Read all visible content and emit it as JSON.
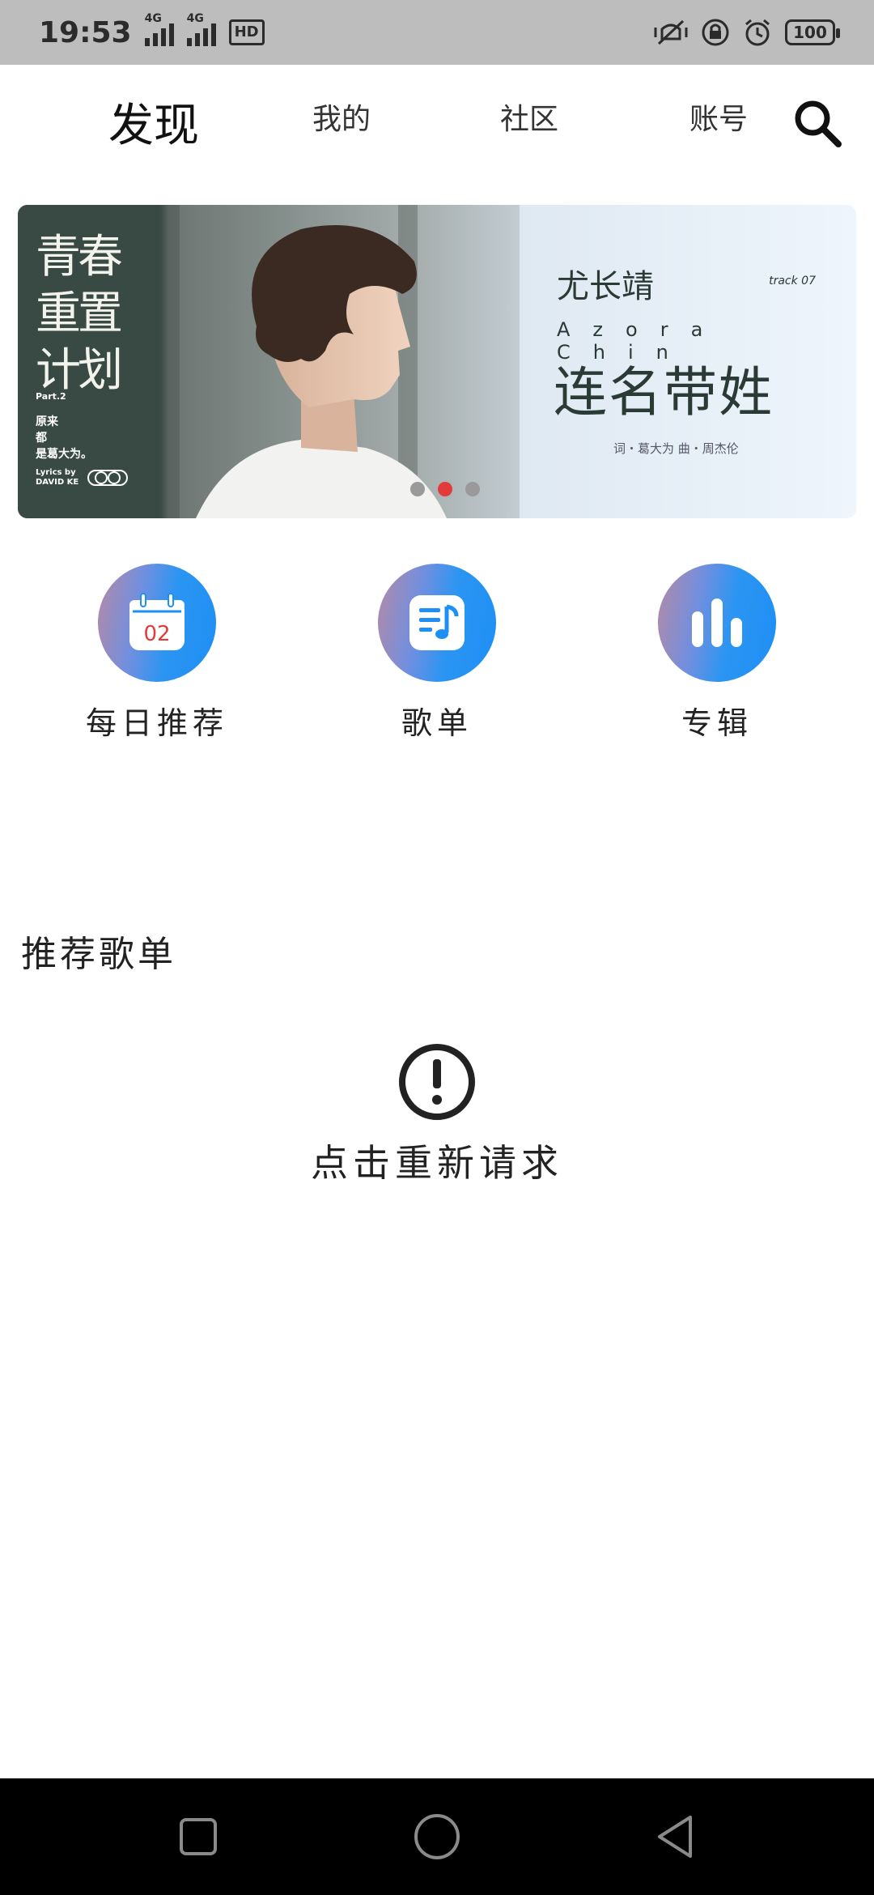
{
  "status_bar": {
    "time": "19:53",
    "network_1": "4G",
    "network_2": "4G",
    "hd": "HD",
    "battery": "100"
  },
  "top_nav": {
    "tabs": [
      {
        "label": "发现",
        "active": true
      },
      {
        "label": "我的",
        "active": false
      },
      {
        "label": "社区",
        "active": false
      },
      {
        "label": "账号",
        "active": false
      }
    ],
    "search_icon": "search-icon"
  },
  "banner": {
    "left_title": "青春重置计划",
    "part": "Part.2",
    "lines": [
      "原来",
      "都",
      "是葛大为。"
    ],
    "lyrics_by": "Lyrics by",
    "lyricist": "DAVID KE",
    "artist_cn": "尤长靖",
    "track": "track 07",
    "artist_en": "Azora Chin",
    "song_title": "连名带姓",
    "credits": "词・葛大为 曲・周杰伦",
    "dots_count": 3,
    "active_dot": 1
  },
  "quick_entries": [
    {
      "label": "每日推荐",
      "icon": "calendar-icon",
      "icon_text": "02"
    },
    {
      "label": "歌单",
      "icon": "playlist-icon"
    },
    {
      "label": "专辑",
      "icon": "bar-chart-icon"
    }
  ],
  "section": {
    "title": "推荐歌单",
    "error_icon": "exclamation-circle-icon",
    "retry_text": "点击重新请求"
  },
  "colors": {
    "accent_blue": "#1e8ff5",
    "active_dot": "#e23b3b",
    "status_bar_bg": "#bdbdbd",
    "nav_bar_bg": "#000000"
  }
}
